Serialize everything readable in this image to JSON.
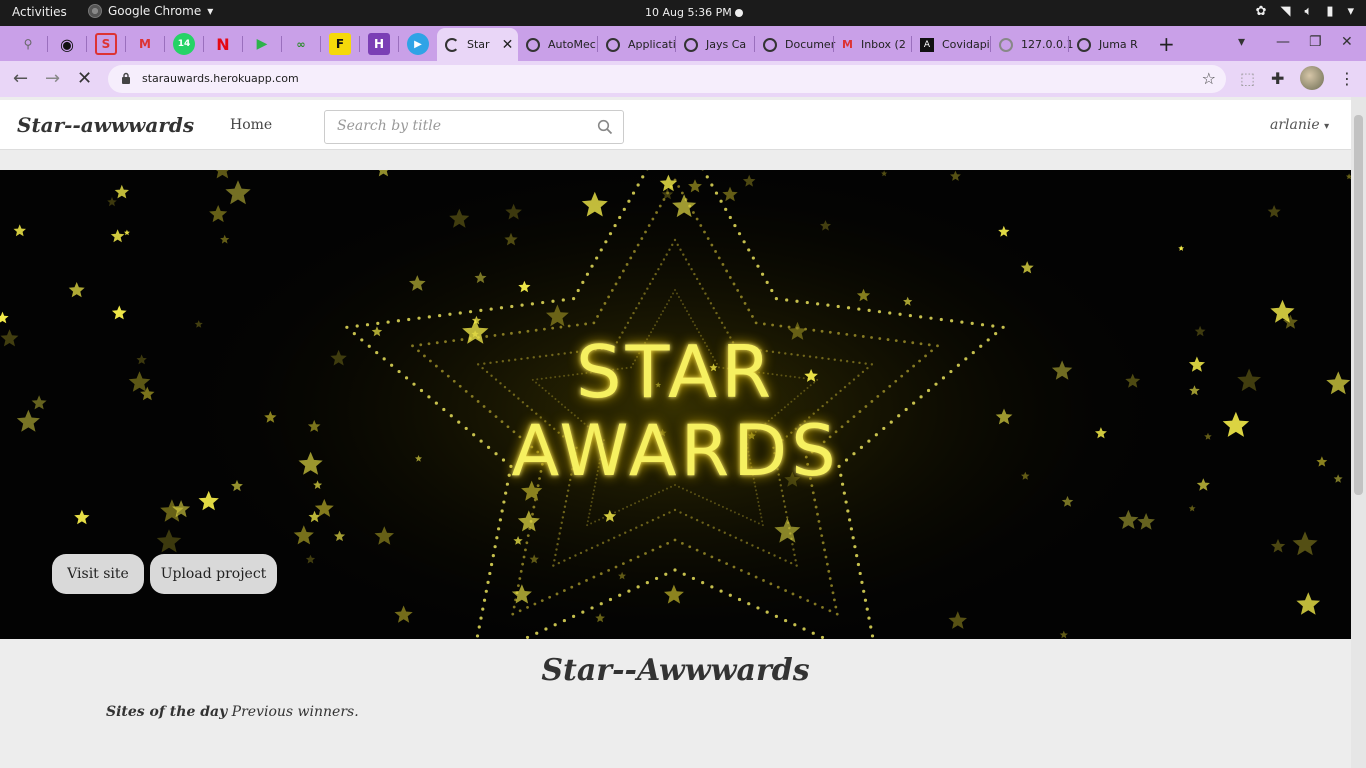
{
  "system": {
    "activities": "Activities",
    "app_name": "Google Chrome",
    "clock": "10 Aug   5:36 PM"
  },
  "tabs": [
    {
      "label": "Star",
      "active": true
    },
    {
      "label": "AutoMec"
    },
    {
      "label": "Applicati"
    },
    {
      "label": "Jays Ca"
    },
    {
      "label": "Documer"
    },
    {
      "label": "Inbox (2"
    },
    {
      "label": "Covidapi"
    },
    {
      "label": "127.0.0.1"
    },
    {
      "label": "Juma R"
    }
  ],
  "omnibox": {
    "url": "starauwards.herokuapp.com"
  },
  "site": {
    "brand": "Star--awwwards",
    "nav_home": "Home",
    "search_placeholder": "Search by title",
    "user": "arlanie"
  },
  "hero": {
    "line1": "STAR",
    "line2": "AWARDS",
    "visit_label": "Visit site",
    "upload_label": "Upload project"
  },
  "main": {
    "title": "Star--Awwwards",
    "sotd_bold": "Sites of the day",
    "sotd_text": "Previous winners."
  },
  "colors": {
    "tab_bar": "#c9a0e8",
    "toolbar": "#e9d6f7",
    "star_gold": "#f6f060"
  }
}
